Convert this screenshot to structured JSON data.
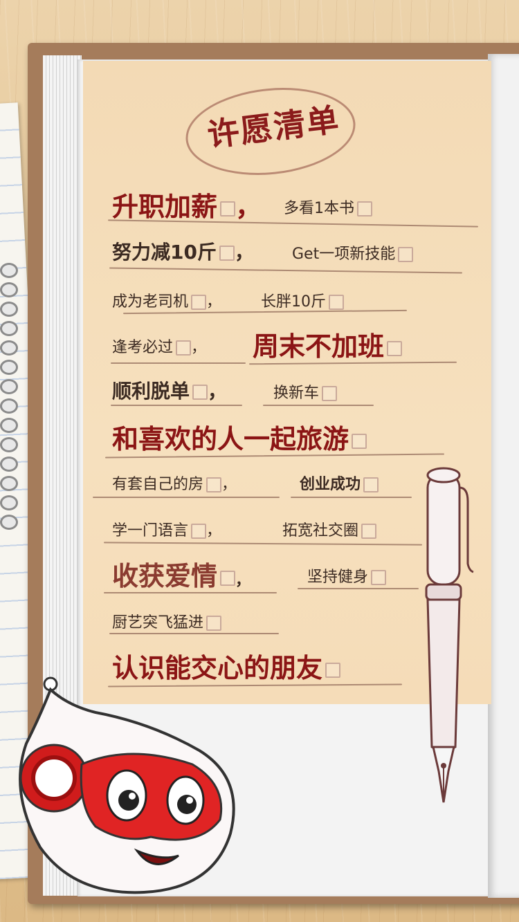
{
  "title": "许愿清单",
  "wishes": [
    {
      "id": "w1a",
      "text": "升职加薪",
      "suffix": "，"
    },
    {
      "id": "w1b",
      "text": "多看1本书",
      "suffix": ""
    },
    {
      "id": "w2a",
      "text": "努力减10斤",
      "suffix": "，"
    },
    {
      "id": "w2b",
      "text": "Get一项新技能",
      "suffix": ""
    },
    {
      "id": "w3a",
      "text": "成为老司机",
      "suffix": "，"
    },
    {
      "id": "w3b",
      "text": "长胖10斤",
      "suffix": ""
    },
    {
      "id": "w4a",
      "text": "逢考必过",
      "suffix": "，"
    },
    {
      "id": "w4b",
      "text": "周末不加班",
      "suffix": ""
    },
    {
      "id": "w5a",
      "text": "顺利脱单",
      "suffix": "，"
    },
    {
      "id": "w5b",
      "text": "换新车",
      "suffix": ""
    },
    {
      "id": "w6",
      "text": "和喜欢的人一起旅游",
      "suffix": ""
    },
    {
      "id": "w7a",
      "text": "有套自己的房",
      "suffix": "，"
    },
    {
      "id": "w7b",
      "text": "创业成功",
      "suffix": ""
    },
    {
      "id": "w8a",
      "text": "学一门语言",
      "suffix": "，"
    },
    {
      "id": "w8b",
      "text": "拓宽社交圈",
      "suffix": ""
    },
    {
      "id": "w9a",
      "text": "收获爱情",
      "suffix": "，"
    },
    {
      "id": "w9b",
      "text": "坚持健身",
      "suffix": ""
    },
    {
      "id": "w10",
      "text": "厨艺突飞猛进",
      "suffix": ""
    },
    {
      "id": "w11",
      "text": "认识能交心的朋友",
      "suffix": ""
    }
  ],
  "colors": {
    "accent": "#8b1515",
    "text_dark": "#3b2a22",
    "paper": "#f4dcb8",
    "wood": "#e3c290"
  },
  "icons": {
    "checkbox": "checkbox-icon",
    "pen": "fountain-pen-icon",
    "mascot": "mascot-icon"
  }
}
